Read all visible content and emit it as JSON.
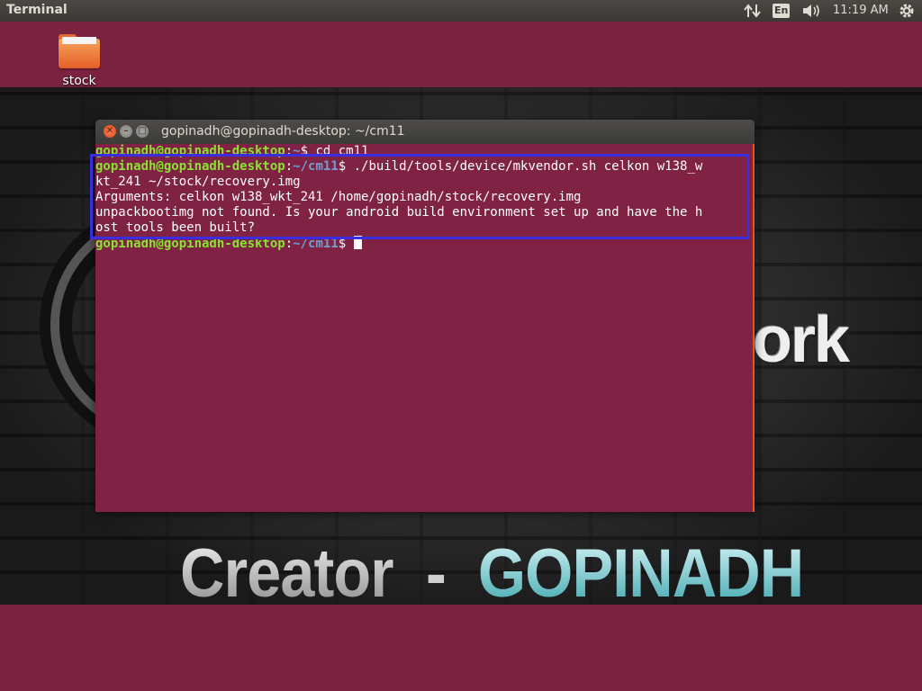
{
  "panel": {
    "app_title": "Terminal",
    "keyboard_layout": "En",
    "clock": "11:19 AM",
    "icons": {
      "network": "network-updown-icon",
      "volume": "volume-icon",
      "system": "gear-icon"
    }
  },
  "desktop": {
    "folder_label": "stock",
    "wallpaper": {
      "fragment": "ork",
      "creator_word": "Creator",
      "dash": "-",
      "creator_name": "GOPINADH"
    }
  },
  "terminal": {
    "title": "gopinadh@gopinadh-desktop: ~/cm11",
    "prompt_user": "gopinadh@gopinadh-desktop",
    "prompt_sep": ":",
    "lines": [
      {
        "path": "~",
        "cmd": "$ cd cm11"
      },
      {
        "path": "~/cm11",
        "cmd": "$ ./build/tools/device/mkvendor.sh celkon w138_w"
      },
      {
        "text": "kt_241 ~/stock/recovery.img"
      },
      {
        "text": "Arguments: celkon w138_wkt_241 /home/gopinadh/stock/recovery.img"
      },
      {
        "text": "unpackbootimg not found. Is your android build environment set up and have the h"
      },
      {
        "text": "ost tools been built?"
      },
      {
        "path": "~/cm11",
        "cmd": "$ "
      }
    ]
  },
  "colors": {
    "terminal_bg": "#7f2243",
    "prompt_user": "#8ae234",
    "prompt_path": "#729fcf",
    "highlight_box": "#3a2ee0"
  }
}
